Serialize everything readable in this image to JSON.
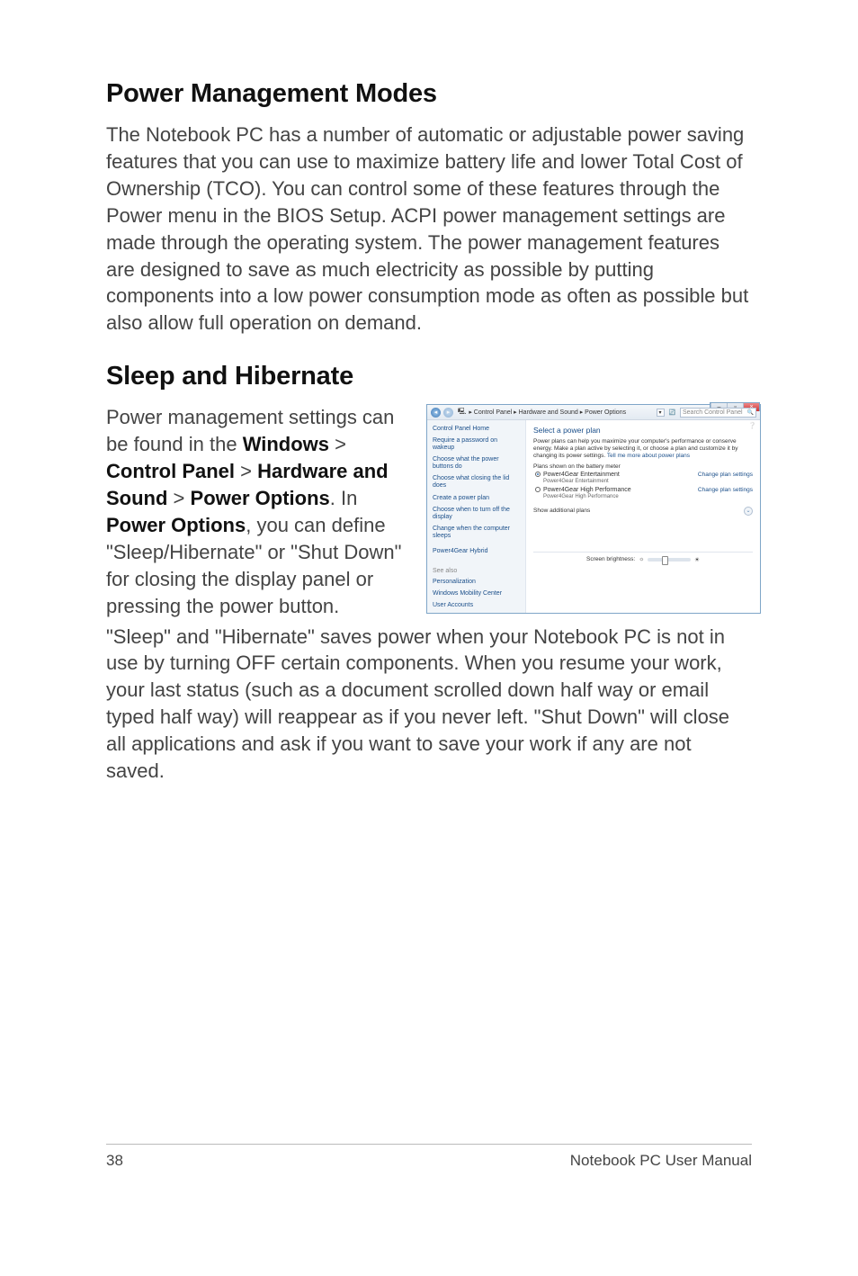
{
  "headings": {
    "h1": "Power Management Modes",
    "h2": "Sleep and Hibernate"
  },
  "para1": "The Notebook PC has a number of automatic or adjustable power saving features that you can use to maximize battery life and lower Total Cost of Ownership (TCO). You can control some of these features through the Power menu in the BIOS Setup. ACPI power management settings are made through the operating system. The power management features are designed to save as much electricity as possible by putting components into a low power consumption mode as often as possible but also allow full operation on demand.",
  "sleep": {
    "left_a": "Power management settings can be found in the ",
    "b1": "Windows",
    "gt1": " > ",
    "b2": "Control Panel",
    "gt2": " > ",
    "b3": "Hardware and Sound",
    "gt3": " > ",
    "b4": "Power Options",
    "left_b": ". In ",
    "b5": "Power Options",
    "left_c": ", you can define \"Sleep/Hibernate\" or \"Shut Down\" for closing the display panel or pressing the power button."
  },
  "para3": "\"Sleep\" and \"Hibernate\" saves power when your Notebook PC is not in use by turning OFF certain components. When you resume your work, your last status (such as a document scrolled down half way or email typed half way) will reappear as if you never left. \"Shut Down\" will close all applications and ask if you want to save your work if any are not saved.",
  "footer": {
    "page": "38",
    "label": "Notebook PC User Manual"
  },
  "win": {
    "breadcrumb": "  ▸ Control Panel ▸ Hardware and Sound ▸ Power Options",
    "search_placeholder": "Search Control Panel",
    "sidebar": {
      "home": "Control Panel Home",
      "l1": "Require a password on wakeup",
      "l2": "Choose what the power buttons do",
      "l3": "Choose what closing the lid does",
      "l4": "Create a power plan",
      "l5": "Choose when to turn off the display",
      "l6": "Change when the computer sleeps",
      "hybrid": "Power4Gear Hybrid",
      "see_also": "See also",
      "s1": "Personalization",
      "s2": "Windows Mobility Center",
      "s3": "User Accounts"
    },
    "main": {
      "title": "Select a power plan",
      "desc_a": "Power plans can help you maximize your computer's performance or conserve energy. Make a plan active by selecting it, or choose a plan and customize it by changing its power settings. ",
      "desc_link": "Tell me more about power plans",
      "section": "Plans shown on the battery meter",
      "plan1": "Power4Gear Entertainment",
      "plan1_sub": "Power4Gear Entertainment",
      "plan2": "Power4Gear High Performance",
      "plan2_sub": "Power4Gear High Performance",
      "change": "Change plan settings",
      "show_add": "Show additional plans",
      "brightness": "Screen brightness:"
    }
  }
}
